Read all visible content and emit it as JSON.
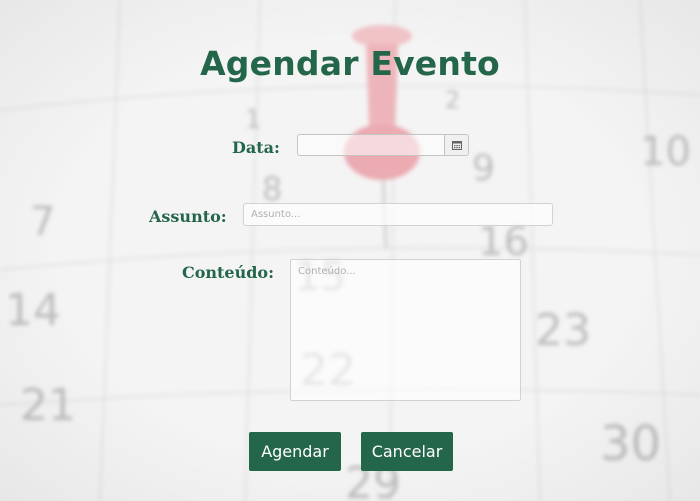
{
  "form": {
    "title": "Agendar Evento",
    "date_label": "Data:",
    "date_value": "",
    "subject_label": "Assunto:",
    "subject_placeholder": "Assunto...",
    "content_label": "Conteúdo:",
    "content_placeholder": "Conteúdo...",
    "submit_label": "Agendar",
    "cancel_label": "Cancelar"
  },
  "icons": {
    "calendar_button": "calendar-icon"
  },
  "colors": {
    "accent": "#23664a",
    "button_text": "#ffffff"
  }
}
